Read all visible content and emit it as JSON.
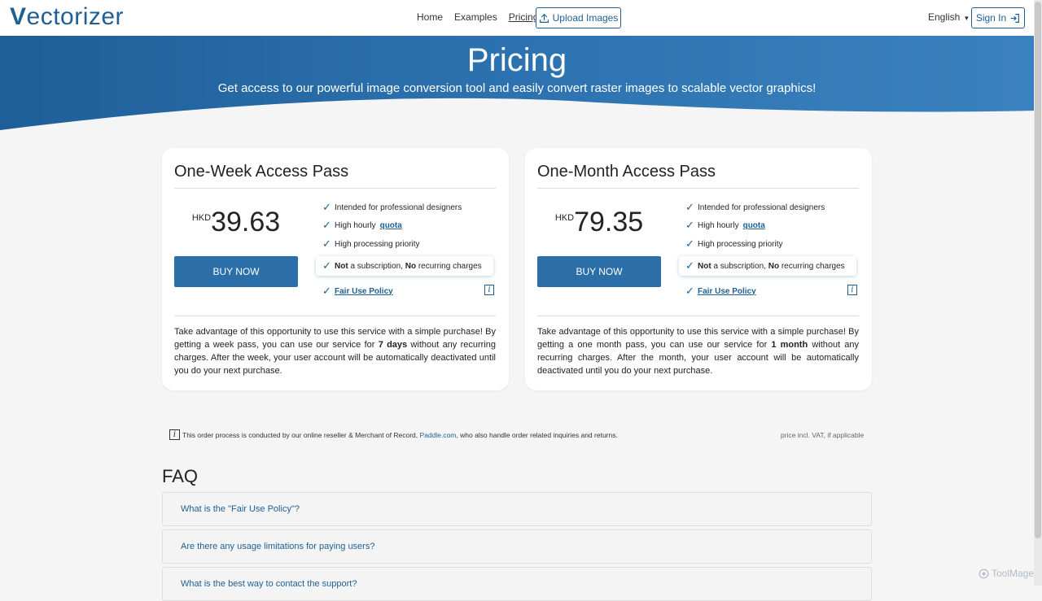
{
  "nav": {
    "logo": "Vectorizer",
    "links": [
      "Home",
      "Examples",
      "Pricing"
    ],
    "upload": "Upload Images",
    "language": "English",
    "signin": "Sign In"
  },
  "hero": {
    "title": "Pricing",
    "subtitle": "Get access to our powerful image conversion tool and easily convert raster images to scalable vector graphics!"
  },
  "plans": [
    {
      "title": "One-Week Access Pass",
      "currency": "HKD",
      "price": "39.63",
      "buy": "BUY NOW",
      "f1": "Intended for professional designers",
      "f2_pre": "High hourly ",
      "f2_link": "quota",
      "f3": "High processing priority",
      "f4_b1": "Not",
      "f4_t1": " a subscription, ",
      "f4_b2": "No",
      "f4_t2": " recurring charges",
      "f5": "Fair Use Policy",
      "desc_pre": "Take advantage of this opportunity to use this service with a simple purchase! By getting a week pass, you can use our service for ",
      "desc_bold": "7 days",
      "desc_post": " without any recurring charges. After the week, your user account will be automatically deactivated until you do your next purchase."
    },
    {
      "title": "One-Month Access Pass",
      "currency": "HKD",
      "price": "79.35",
      "buy": "BUY NOW",
      "f1": "Intended for professional designers",
      "f2_pre": "High hourly ",
      "f2_link": "quota",
      "f3": "High processing priority",
      "f4_b1": "Not",
      "f4_t1": " a subscription, ",
      "f4_b2": "No",
      "f4_t2": " recurring charges",
      "f5": "Fair Use Policy",
      "desc_pre": "Take advantage of this opportunity to use this service with a simple purchase! By getting a one month pass, you can use our service for ",
      "desc_bold": "1 month",
      "desc_post": " without any recurring charges. After the month, your user account will be automatically deactivated until you do your next purchase."
    }
  ],
  "note": {
    "pre": "This order process is conducted by our online reseller & Merchant of Record, ",
    "link": "Paddle.com",
    "post": ", who also handle order related inquiries and returns.",
    "vat": "price incl. VAT, if applicable"
  },
  "faq": {
    "title": "FAQ",
    "items": [
      "What is the \"Fair Use Policy\"?",
      "Are there any usage limitations for paying users?",
      "What is the best way to contact the support?"
    ]
  },
  "watermark": "ToolMage",
  "colors": {
    "brand": "#1e5f94",
    "button": "#2b6ea8",
    "hero": "#2f75b5"
  }
}
